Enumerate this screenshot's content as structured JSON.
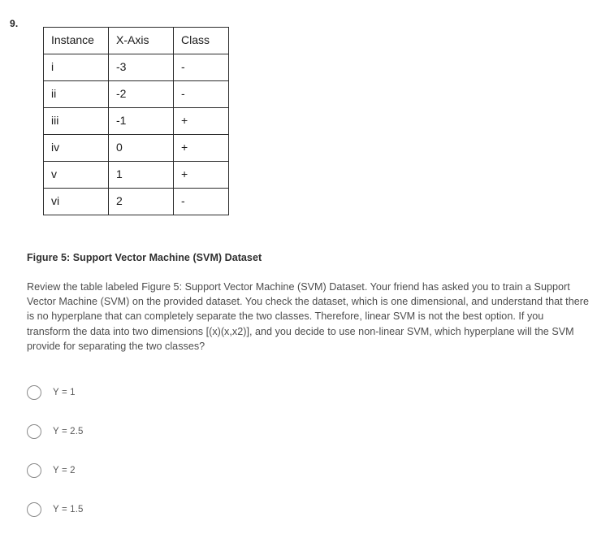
{
  "question": {
    "number": "9.",
    "figure_caption": "Figure 5: Support Vector Machine (SVM) Dataset",
    "body": "Review the table labeled Figure 5: Support Vector Machine (SVM) Dataset. Your friend has asked you to train a Support Vector Machine (SVM) on the provided dataset. You check the dataset, which is one dimensional, and understand that there is no hyperplane that can completely separate the two classes. Therefore, linear SVM is not the best option. If you transform the data into two dimensions [(x)(x,x2)], and you decide to use non-linear SVM, which hyperplane will the SVM provide for separating the two classes?"
  },
  "table": {
    "headers": [
      "Instance",
      "X-Axis",
      "Class"
    ],
    "rows": [
      [
        "i",
        "-3",
        "-"
      ],
      [
        "ii",
        "-2",
        "-"
      ],
      [
        "iii",
        "-1",
        "+"
      ],
      [
        "iv",
        "0",
        "+"
      ],
      [
        "v",
        "1",
        "+"
      ],
      [
        "vi",
        "2",
        "-"
      ]
    ]
  },
  "options": [
    {
      "id": "option-1",
      "label": "Y = 1",
      "selected": false
    },
    {
      "id": "option-2",
      "label": "Y = 2.5",
      "selected": false
    },
    {
      "id": "option-3",
      "label": "Y = 2",
      "selected": false
    },
    {
      "id": "option-4",
      "label": "Y = 1.5",
      "selected": false
    }
  ],
  "colors": {
    "table_border": "#2b2b2b",
    "table_text": "#1a1a1a",
    "body_text": "#4d4d4d",
    "caption_text": "#2f2f2f",
    "radio_outline": "#8a8a8a",
    "option_text": "#5a5a5a",
    "page_background": "#ffffff"
  }
}
